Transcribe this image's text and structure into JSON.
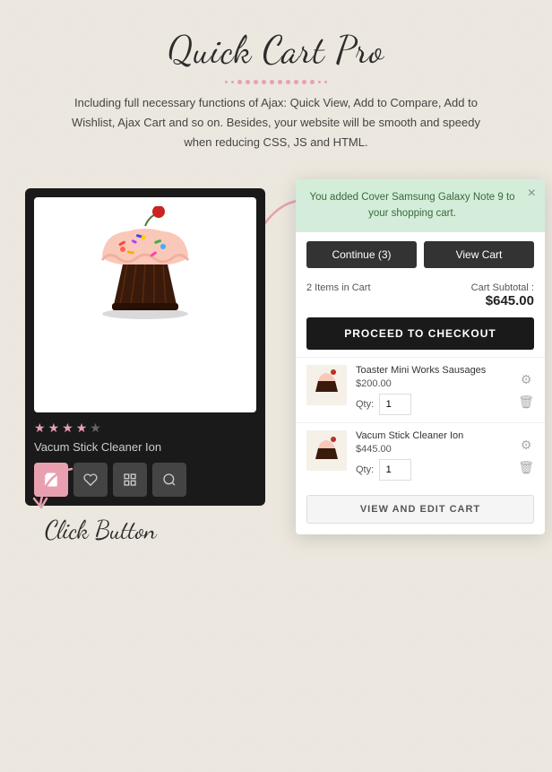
{
  "header": {
    "title": "Quick Cart Pro",
    "dotted_count": 13,
    "description": "Including full necessary functions of Ajax: Quick View, Add to Compare, Add to Wishlist, Ajax Cart and so on. Besides, your website will be smooth and speedy when reducing CSS, JS and HTML."
  },
  "product_card": {
    "name": "Vacum Stick Cleaner Ion",
    "stars": [
      true,
      true,
      true,
      true,
      false
    ],
    "buttons": {
      "cart": "🛒",
      "wishlist": "♡",
      "compare": "⧉",
      "quickview": "🔍"
    }
  },
  "click_label": "Click Button",
  "cart_popup": {
    "close_label": "×",
    "notification": "You added Cover Samsung Galaxy Note 9 to your shopping cart.",
    "continue_button": "Continue (3)",
    "view_cart_button": "View Cart",
    "items_count": "2 Items in Cart",
    "subtotal_label": "Cart Subtotal :",
    "subtotal_amount": "$645.00",
    "checkout_button": "PROCEED TO CHECKOUT",
    "items": [
      {
        "name": "Toaster Mini Works Sausages",
        "price": "$200.00",
        "qty": 1
      },
      {
        "name": "Vacum Stick Cleaner Ion",
        "price": "$445.00",
        "qty": 1
      }
    ],
    "view_edit_button": "VIEW AND EDIT CART"
  }
}
